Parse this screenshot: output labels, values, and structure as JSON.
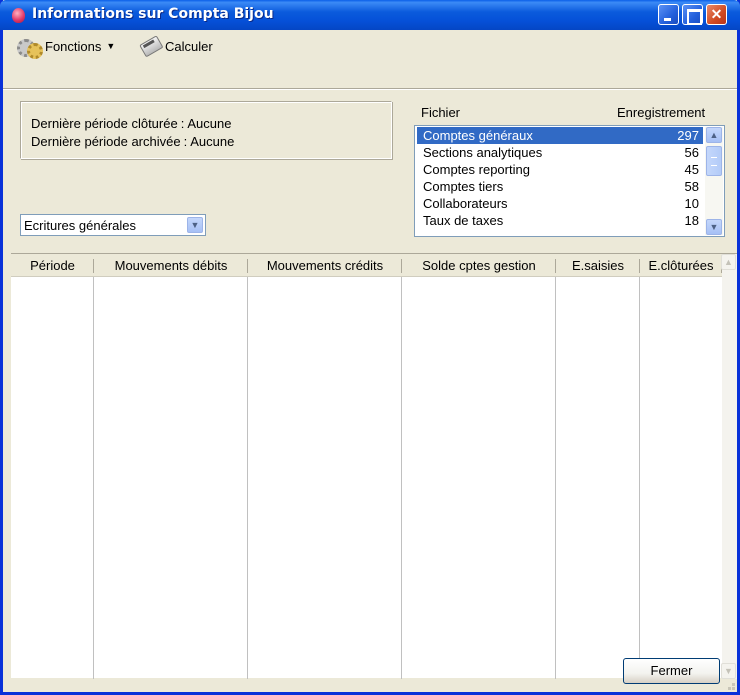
{
  "window": {
    "title": "Informations sur Compta Bijou"
  },
  "toolbar": {
    "fonctions_label": "Fonctions",
    "calculer_label": "Calculer"
  },
  "info": {
    "derniere_cloturee_label": "Dernière période clôturée",
    "derniere_cloturee_value": "Aucune",
    "derniere_archivee_label": "Dernière période archivée",
    "derniere_archivee_value": "Aucune",
    "separator": ":"
  },
  "journal_select": {
    "value": "Ecritures générales"
  },
  "filelist": {
    "header_file": "Fichier",
    "header_count": "Enregistrement",
    "rows": [
      {
        "name": "Comptes généraux",
        "count": "297"
      },
      {
        "name": "Sections analytiques",
        "count": "56"
      },
      {
        "name": "Comptes reporting",
        "count": "45"
      },
      {
        "name": "Comptes tiers",
        "count": "58"
      },
      {
        "name": "Collaborateurs",
        "count": "10"
      },
      {
        "name": "Taux de taxes",
        "count": "18"
      }
    ]
  },
  "grid": {
    "columns": [
      "Période",
      "Mouvements débits",
      "Mouvements crédits",
      "Solde cptes gestion",
      "E.saisies",
      "E.clôturées"
    ]
  },
  "footer": {
    "close_label": "Fermer"
  }
}
